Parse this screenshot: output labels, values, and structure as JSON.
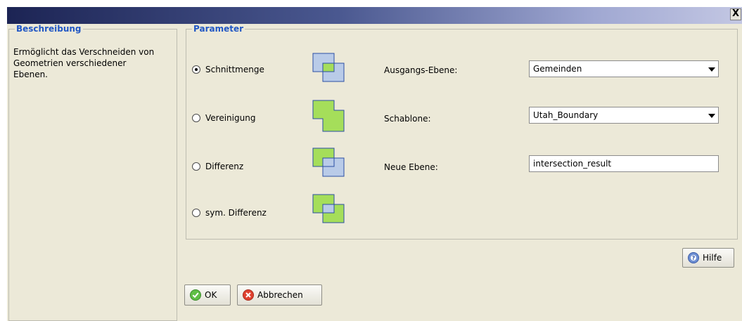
{
  "window": {
    "close_label": "X"
  },
  "description": {
    "legend": "Beschreibung",
    "text_line1": "Ermöglicht das Verschneiden von",
    "text_line2": "Geometrien verschiedener",
    "text_line3": "Ebenen."
  },
  "parameters": {
    "legend": "Parameter",
    "operations": [
      {
        "label": "Schnittmenge",
        "checked": true,
        "icon": "intersection-icon"
      },
      {
        "label": "Vereinigung",
        "checked": false,
        "icon": "union-icon"
      },
      {
        "label": "Differenz",
        "checked": false,
        "icon": "difference-icon"
      },
      {
        "label": "sym. Differenz",
        "checked": false,
        "icon": "sym-difference-icon"
      }
    ],
    "source_layer": {
      "label": "Ausgangs-Ebene:",
      "value": "Gemeinden"
    },
    "template_layer": {
      "label": "Schablone:",
      "value": "Utah_Boundary"
    },
    "new_layer": {
      "label": "Neue Ebene:",
      "value": "intersection_result"
    }
  },
  "buttons": {
    "help_label": "Hilfe",
    "ok_label": "OK",
    "cancel_label": "Abbrechen"
  },
  "colors": {
    "legend_blue": "#2157c4",
    "shape_blue": "#b9cbe8",
    "shape_green": "#a5de5a",
    "shape_border": "#2c4fa3"
  }
}
